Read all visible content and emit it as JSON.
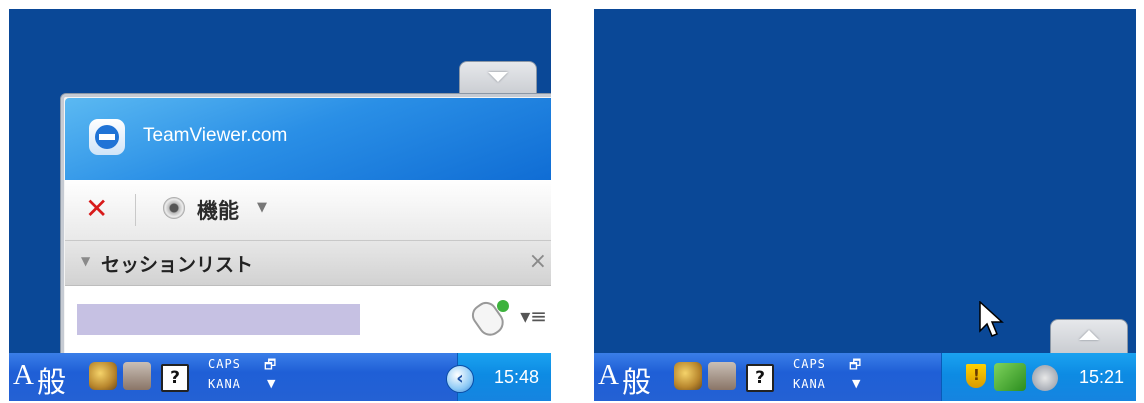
{
  "left": {
    "tv_window": {
      "title": "TeamViewer.com",
      "function_label": "機能",
      "session_list_label": "セッションリスト"
    },
    "taskbar": {
      "ime_mode": "A",
      "ime_kanji": "般",
      "caps": "CAPS",
      "kana": "KANA",
      "clock": "15:48"
    }
  },
  "right": {
    "taskbar": {
      "ime_mode": "A",
      "ime_kanji": "般",
      "caps": "CAPS",
      "kana": "KANA",
      "clock": "15:21"
    }
  },
  "icons": {
    "collapse_tab": "triangle-down-icon",
    "expand_tab": "triangle-up-icon",
    "close": "red-x-icon",
    "webcam": "webcam-icon",
    "remote_mouse": "mouse-icon",
    "menu": "list-menu-icon",
    "show_hidden": "chevron-left-icon"
  },
  "colors": {
    "desktop": "#0a4897",
    "taskbar": "#2461d4",
    "tray": "#0d8be3",
    "session_placeholder": "#c6c1e3",
    "tv_header": "#2a8fe6"
  }
}
